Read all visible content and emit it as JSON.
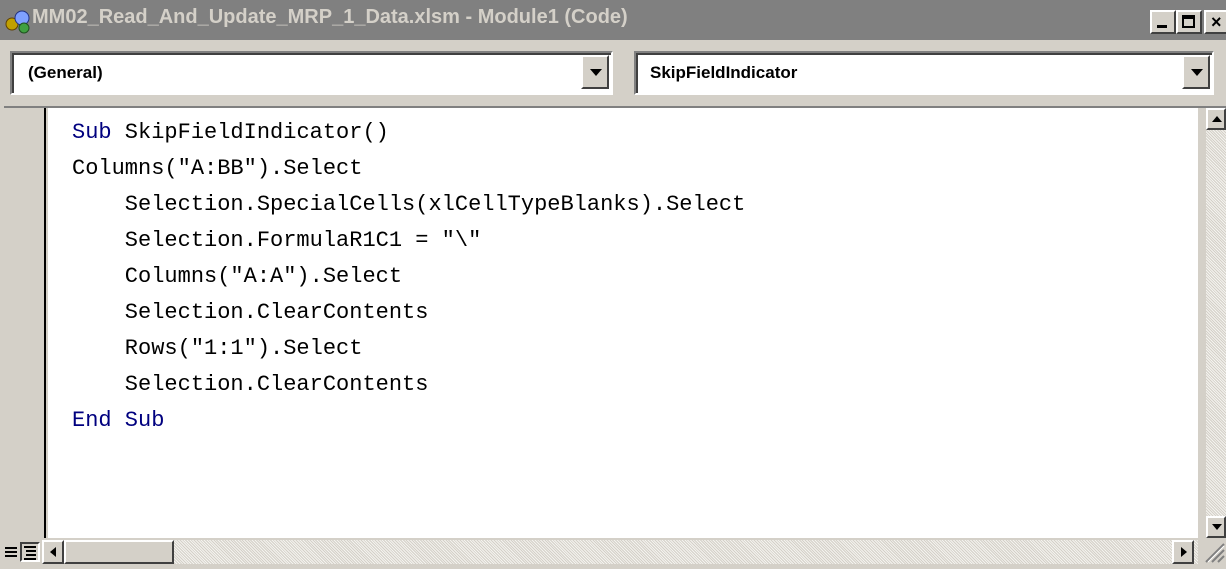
{
  "window": {
    "title": "MM02_Read_And_Update_MRP_1_Data.xlsm - Module1 (Code)",
    "icon": "vba-project-icon",
    "controls": {
      "minimize": "minimize-icon",
      "maximize": "maximize-icon",
      "close": "×"
    }
  },
  "object_dropdown": {
    "selected": "(General)"
  },
  "procedure_dropdown": {
    "selected": "SkipFieldIndicator"
  },
  "code": {
    "lines": [
      {
        "kw": "Sub",
        "rest": " SkipFieldIndicator()"
      },
      {
        "kw": "",
        "rest": "Columns(\"A:BB\").Select"
      },
      {
        "kw": "",
        "rest": "    Selection.SpecialCells(xlCellTypeBlanks).Select"
      },
      {
        "kw": "",
        "rest": "    Selection.FormulaR1C1 = \"\\\""
      },
      {
        "kw": "",
        "rest": "    Columns(\"A:A\").Select"
      },
      {
        "kw": "",
        "rest": "    Selection.ClearContents"
      },
      {
        "kw": "",
        "rest": "    Rows(\"1:1\").Select"
      },
      {
        "kw": "",
        "rest": "    Selection.ClearContents"
      },
      {
        "kw": "End Sub",
        "rest": ""
      }
    ]
  },
  "colors": {
    "keyword": "#00007f",
    "title_bar_inactive": "#808080",
    "title_text_inactive": "#d4d0c8",
    "face": "#d4d0c8"
  }
}
